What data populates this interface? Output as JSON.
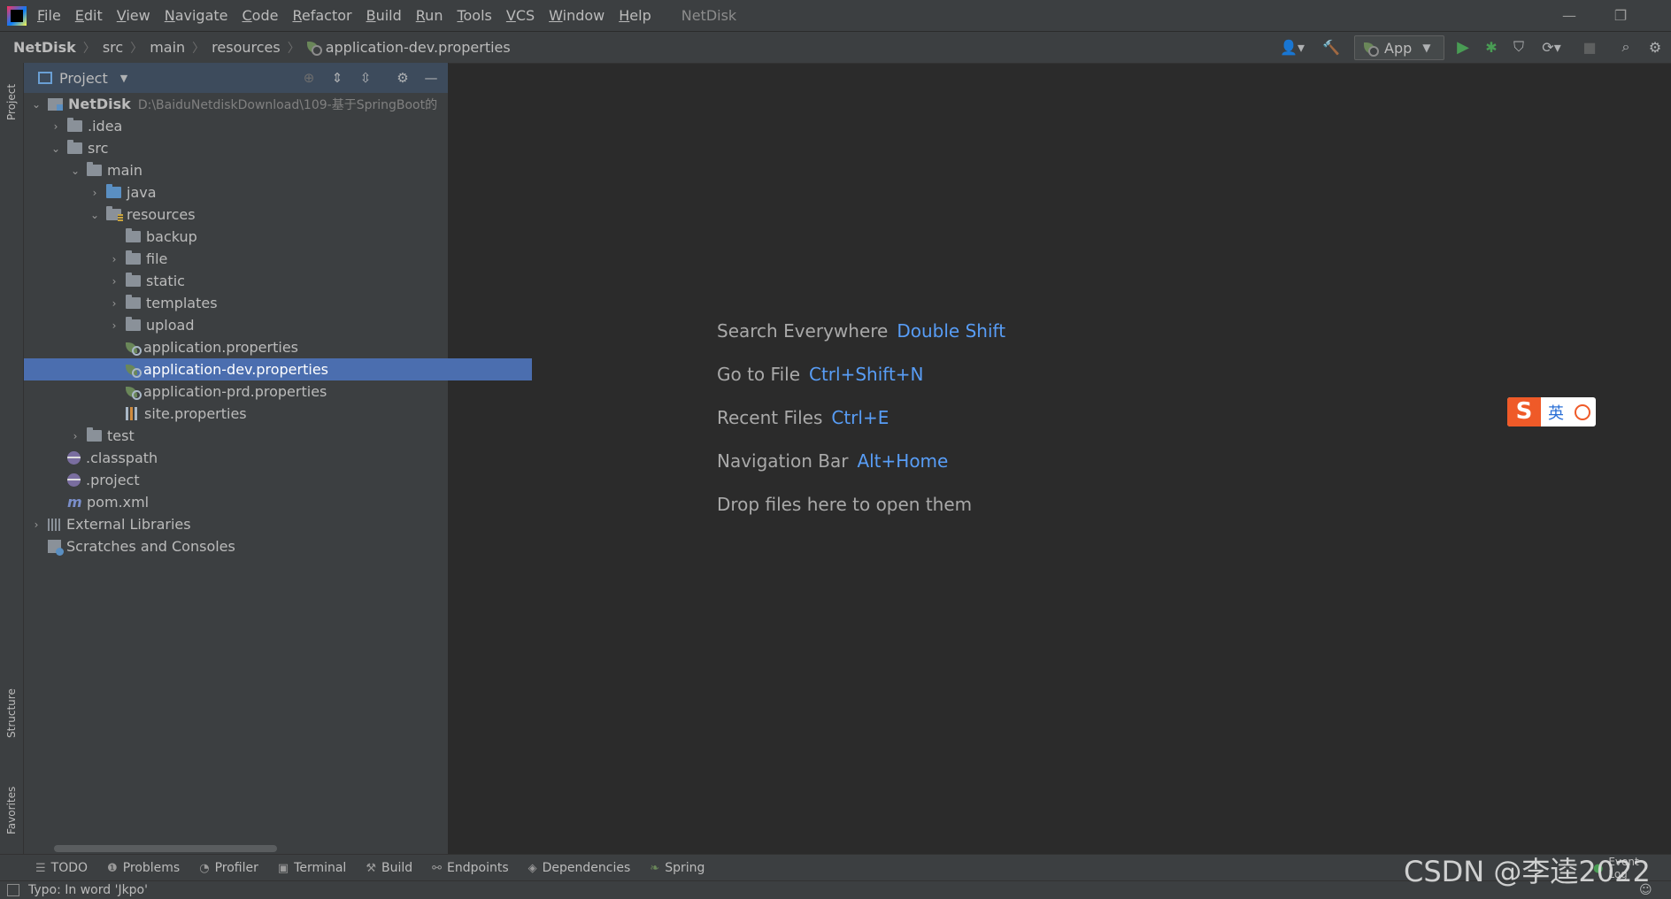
{
  "menubar": {
    "items": [
      "File",
      "Edit",
      "View",
      "Navigate",
      "Code",
      "Refactor",
      "Build",
      "Run",
      "Tools",
      "VCS",
      "Window",
      "Help"
    ],
    "window_title": "NetDisk"
  },
  "navbar": {
    "crumbs": [
      "NetDisk",
      "src",
      "main",
      "resources",
      "application-dev.properties"
    ],
    "run_config": "App"
  },
  "left_strip": {
    "project": "Project",
    "structure": "Structure",
    "favorites": "Favorites"
  },
  "project_panel": {
    "title": "Project",
    "root_path": "D:\\BaiduNetdiskDownload\\109-基于SpringBoot的",
    "tree": [
      {
        "label": "NetDisk"
      },
      {
        "label": ".idea"
      },
      {
        "label": "src"
      },
      {
        "label": "main"
      },
      {
        "label": "java"
      },
      {
        "label": "resources"
      },
      {
        "label": "backup"
      },
      {
        "label": "file"
      },
      {
        "label": "static"
      },
      {
        "label": "templates"
      },
      {
        "label": "upload"
      },
      {
        "label": "application.properties"
      },
      {
        "label": "application-dev.properties"
      },
      {
        "label": "application-prd.properties"
      },
      {
        "label": "site.properties"
      },
      {
        "label": "test"
      },
      {
        "label": ".classpath"
      },
      {
        "label": ".project"
      },
      {
        "label": "pom.xml"
      },
      {
        "label": "External Libraries"
      },
      {
        "label": "Scratches and Consoles"
      }
    ]
  },
  "editor_hints": [
    {
      "text": "Search Everywhere",
      "key": "Double Shift"
    },
    {
      "text": "Go to File",
      "key": "Ctrl+Shift+N"
    },
    {
      "text": "Recent Files",
      "key": "Ctrl+E"
    },
    {
      "text": "Navigation Bar",
      "key": "Alt+Home"
    },
    {
      "text": "Drop files here to open them",
      "key": ""
    }
  ],
  "bottom_tabs": [
    "TODO",
    "Problems",
    "Profiler",
    "Terminal",
    "Build",
    "Endpoints",
    "Dependencies",
    "Spring"
  ],
  "status": {
    "message": "Typo: In word 'Jkpo'",
    "event_log": "Event Log"
  },
  "ime": {
    "label": "英"
  },
  "watermark": "CSDN @李逵2022",
  "colors": {
    "selection": "#4b6eaf",
    "hint_key": "#589df6",
    "panel": "#3c3f41",
    "editor": "#2b2b2b"
  }
}
